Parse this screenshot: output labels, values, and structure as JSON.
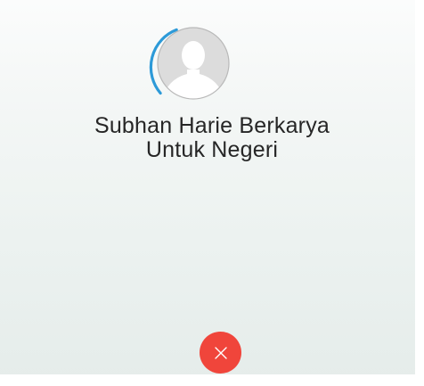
{
  "call": {
    "contact_name": "Subhan Harie Berkarya\nUntuk Negeri"
  },
  "icons": {
    "avatar": "default-person-avatar-icon",
    "progress_ring": "calling-progress-arc-icon",
    "end_call": "close-x-icon"
  },
  "colors": {
    "progress_arc": "#2d9ad8",
    "avatar_fill": "#dcdcdc",
    "avatar_border": "#b9b9b9",
    "end_call_button": "#f0453b",
    "name_text": "#262626"
  }
}
